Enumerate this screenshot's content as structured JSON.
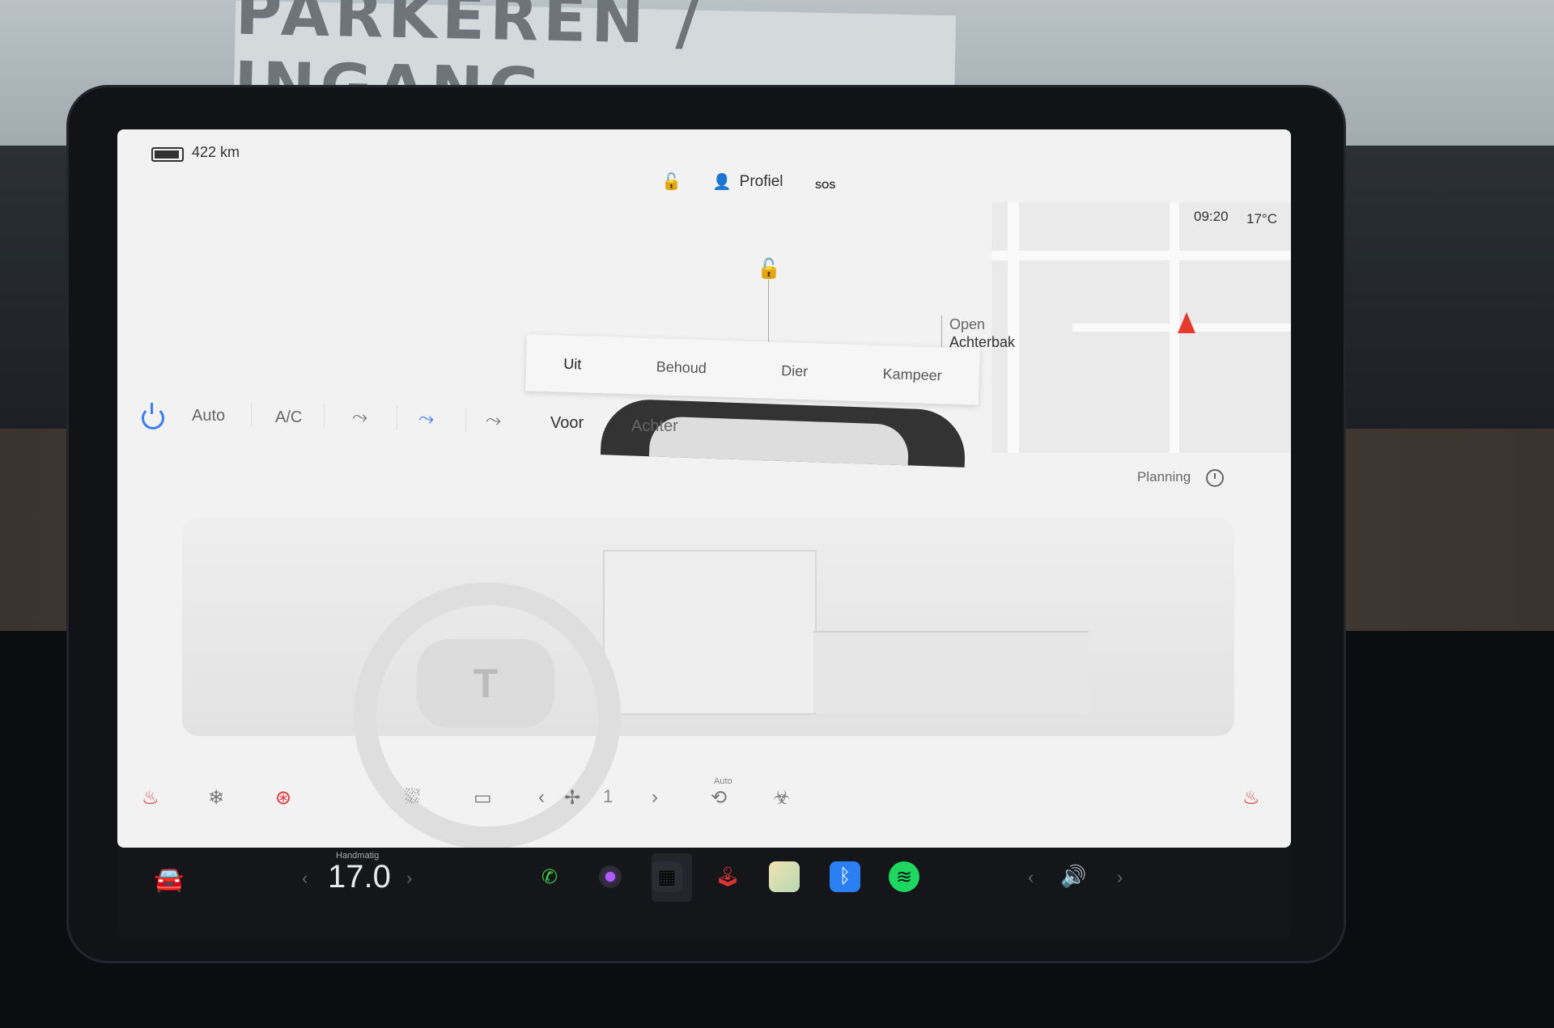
{
  "background": {
    "sign_text": "PARKEREN / INGANG"
  },
  "status": {
    "range": "422 km",
    "profile_label": "Profiel",
    "sos_label": "SOS",
    "time": "09:20",
    "outside_temp": "17°C"
  },
  "car_view": {
    "trunk_status": "Open",
    "trunk_label": "Achterbak"
  },
  "modes": {
    "items": [
      {
        "label": "Uit"
      },
      {
        "label": "Behoud"
      },
      {
        "label": "Dier"
      },
      {
        "label": "Kampeer"
      }
    ]
  },
  "climate": {
    "auto_label": "Auto",
    "ac_label": "A/C",
    "front_label": "Voor",
    "rear_label": "Achter",
    "planning_label": "Planning",
    "fan_speed": "1",
    "recirc_auto_label": "Auto",
    "mode_label": "Handmatig",
    "set_temp": "17.0"
  },
  "colors": {
    "accent": "#3b7cf5",
    "heat": "#d33333",
    "nav_arrow": "#e53b2d",
    "spotify": "#1ed760",
    "bluetooth": "#2a7ff3",
    "phone": "#3fd14a"
  },
  "icons": {
    "battery": "battery-icon",
    "lock": "unlock-icon",
    "profile": "person-icon",
    "power": "power-icon",
    "fan": "fan-icon",
    "seat_heat": "seat-heat-icon",
    "wheel_heat": "steering-heat-icon",
    "defrost": "defrost-icon",
    "car": "car-icon",
    "volume": "volume-icon"
  }
}
